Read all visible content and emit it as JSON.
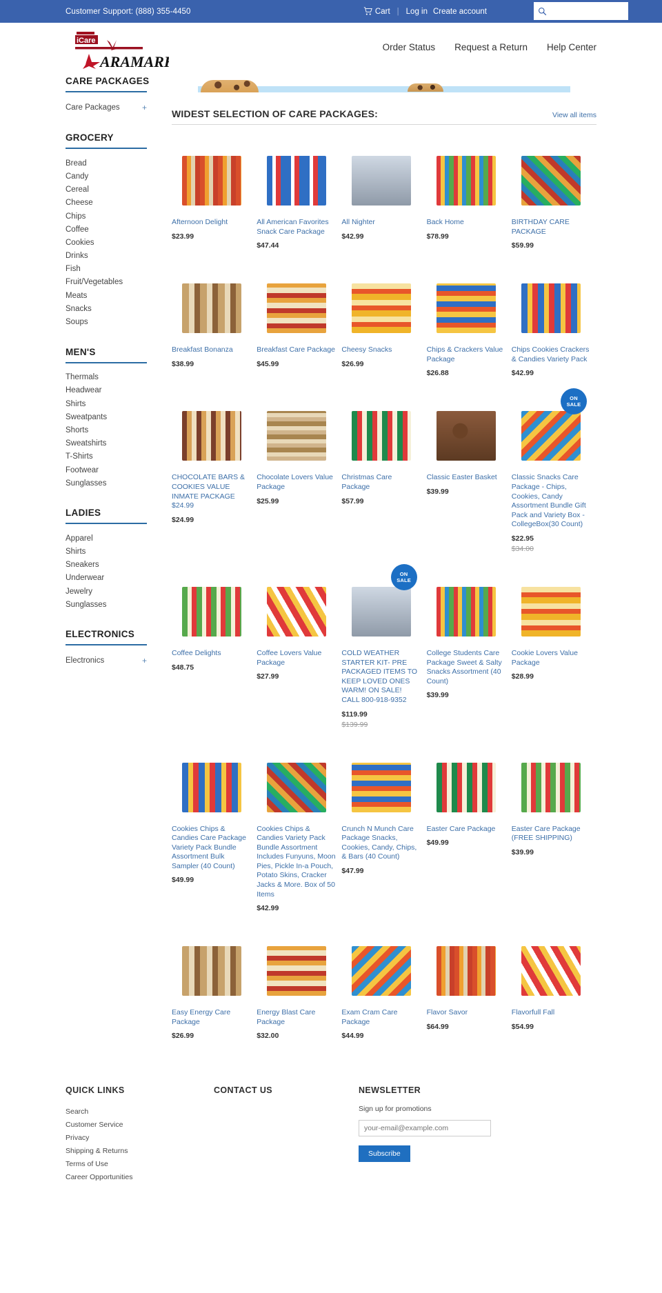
{
  "topbar": {
    "support": "Customer Support: (888) 355-4450",
    "cart": "Cart",
    "login": "Log in",
    "create_account": "Create account",
    "search_placeholder": "",
    "search_value": "",
    "bg_color": "#3a62ad"
  },
  "header": {
    "logo_top": "iCare",
    "logo_main": "ARAMARK",
    "nav": [
      {
        "label": "Order Status"
      },
      {
        "label": "Request a Return"
      },
      {
        "label": "Help Center"
      }
    ]
  },
  "sidebar": {
    "groups": [
      {
        "title": "CARE PACKAGES",
        "items": [
          {
            "label": "Care Packages",
            "expand": "+"
          }
        ]
      },
      {
        "title": "GROCERY",
        "items": [
          {
            "label": "Bread"
          },
          {
            "label": "Candy"
          },
          {
            "label": "Cereal"
          },
          {
            "label": "Cheese"
          },
          {
            "label": "Chips"
          },
          {
            "label": "Coffee"
          },
          {
            "label": "Cookies"
          },
          {
            "label": "Drinks"
          },
          {
            "label": "Fish"
          },
          {
            "label": "Fruit/Vegetables"
          },
          {
            "label": "Meats"
          },
          {
            "label": "Snacks"
          },
          {
            "label": "Soups"
          }
        ]
      },
      {
        "title": "MEN'S",
        "items": [
          {
            "label": "Thermals"
          },
          {
            "label": "Headwear"
          },
          {
            "label": "Shirts"
          },
          {
            "label": "Sweatpants"
          },
          {
            "label": "Shorts"
          },
          {
            "label": "Sweatshirts"
          },
          {
            "label": "T-Shirts"
          },
          {
            "label": "Footwear"
          },
          {
            "label": "Sunglasses"
          }
        ]
      },
      {
        "title": "LADIES",
        "items": [
          {
            "label": "Apparel"
          },
          {
            "label": "Shirts"
          },
          {
            "label": "Sneakers"
          },
          {
            "label": "Underwear"
          },
          {
            "label": "Jewelry"
          },
          {
            "label": "Sunglasses"
          }
        ]
      },
      {
        "title": "ELECTRONICS",
        "items": [
          {
            "label": "Electronics",
            "expand": "+"
          }
        ]
      }
    ]
  },
  "main": {
    "section_title": "WIDEST SELECTION OF CARE PACKAGES:",
    "view_all": "View all items",
    "sale_badge_line1": "ON",
    "sale_badge_line2": "SALE",
    "products": [
      {
        "title": "Afternoon Delight",
        "price": "$23.99",
        "img": "snackA"
      },
      {
        "title": "All American Favorites Snack Care Package",
        "price": "$47.44",
        "img": "snackB"
      },
      {
        "title": "All Nighter",
        "price": "$42.99",
        "img": "snackK"
      },
      {
        "title": "Back Home",
        "price": "$78.99",
        "img": "snackD"
      },
      {
        "title": "BIRTHDAY CARE PACKAGE",
        "price": "$59.99",
        "img": "snackE"
      },
      {
        "title": "Breakfast Bonanza",
        "price": "$38.99",
        "img": "snackI"
      },
      {
        "title": "Breakfast Care Package",
        "price": "$45.99",
        "img": "snackM"
      },
      {
        "title": "Cheesy Snacks",
        "price": "$26.99",
        "img": "snackC"
      },
      {
        "title": "Chips & Crackers Value Package",
        "price": "$26.88",
        "img": "snackH"
      },
      {
        "title": "Chips Cookies Crackers & Candies Variety Pack",
        "price": "$42.99",
        "img": "snackL"
      },
      {
        "title": "CHOCOLATE BARS & COOKIES VALUE INMATE PACKAGE $24.99",
        "price": "$24.99",
        "img": "snackQ"
      },
      {
        "title": "Chocolate Lovers Value Package",
        "price": "$25.99",
        "img": "snackP"
      },
      {
        "title": "Christmas Care Package",
        "price": "$57.99",
        "img": "snackG"
      },
      {
        "title": "Classic Easter Basket",
        "price": "$39.99",
        "img": "snackF"
      },
      {
        "title": "Classic Snacks Care Package - Chips, Cookies, Candy Assortment Bundle Gift Pack and Variety Box - CollegeBox(30 Count)",
        "price": "$22.95",
        "old_price": "$34.00",
        "img": "snackO",
        "badge": true
      },
      {
        "title": "Coffee Delights",
        "price": "$48.75",
        "img": "snackN"
      },
      {
        "title": "Coffee Lovers Value Package",
        "price": "$27.99",
        "img": "snackJ"
      },
      {
        "title": "COLD WEATHER STARTER KIT- PRE PACKAGED ITEMS TO KEEP LOVED ONES WARM! ON SALE! CALL 800-918-9352",
        "price": "$119.99",
        "old_price": "$139.99",
        "img": "snackK",
        "badge": true
      },
      {
        "title": "College Students Care Package Sweet & Salty Snacks Assortment (40 Count)",
        "price": "$39.99",
        "img": "snackD"
      },
      {
        "title": "Cookie Lovers Value Package",
        "price": "$28.99",
        "img": "snackC"
      },
      {
        "title": "Cookies Chips & Candies Care Package Variety Pack Bundle Assortment Bulk Sampler (40 Count)",
        "price": "$49.99",
        "img": "snackL"
      },
      {
        "title": "Cookies Chips & Candies Variety Pack Bundle Assortment Includes Funyuns, Moon Pies, Pickle In-a Pouch, Potato Skins, Cracker Jacks & More. Box of 50 Items",
        "price": "$42.99",
        "img": "snackE"
      },
      {
        "title": "Crunch N Munch Care Package Snacks, Cookies, Candy, Chips, & Bars (40 Count)",
        "price": "$47.99",
        "img": "snackH"
      },
      {
        "title": "Easter Care Package",
        "price": "$49.99",
        "img": "snackG"
      },
      {
        "title": "Easter Care Package (FREE SHIPPING)",
        "price": "$39.99",
        "img": "snackN"
      },
      {
        "title": "Easy Energy Care Package",
        "price": "$26.99",
        "img": "snackI"
      },
      {
        "title": "Energy Blast Care Package",
        "price": "$32.00",
        "img": "snackM"
      },
      {
        "title": "Exam Cram Care Package",
        "price": "$44.99",
        "img": "snackO"
      },
      {
        "title": "Flavor Savor",
        "price": "$64.99",
        "img": "snackA"
      },
      {
        "title": "Flavorfull Fall",
        "price": "$54.99",
        "img": "snackJ"
      }
    ]
  },
  "footer": {
    "quick_links_title": "QUICK LINKS",
    "quick_links": [
      {
        "label": "Search"
      },
      {
        "label": "Customer Service"
      },
      {
        "label": "Privacy"
      },
      {
        "label": "Shipping & Returns"
      },
      {
        "label": "Terms of Use"
      },
      {
        "label": "Career Opportunities"
      }
    ],
    "contact_title": "CONTACT US",
    "newsletter_title": "NEWSLETTER",
    "newsletter_note": "Sign up for promotions",
    "email_placeholder": "your-email@example.com",
    "subscribe_label": "Subscribe",
    "accent_color": "#1f6fc0"
  }
}
